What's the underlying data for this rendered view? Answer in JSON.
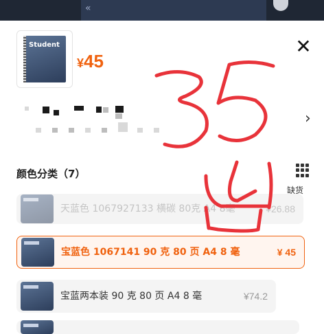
{
  "product": {
    "price_symbol": "¥",
    "price": "45",
    "thumb_title": "Student"
  },
  "section": {
    "title": "颜色分类（7）",
    "out_of_stock": "缺货"
  },
  "options": [
    {
      "label": "天蓝色 1067927133 横碳 80克 A4 8毫",
      "price": "¥26.88",
      "state": "disabled"
    },
    {
      "label": "宝蓝色 1067141 90 克 80 页 A4 8 毫",
      "price": "¥ 45",
      "state": "selected"
    },
    {
      "label": "宝蓝两本装 90 克 80 页 A4 8 毫",
      "price": "¥74.2",
      "state": "normal"
    }
  ],
  "annotation": {
    "text": "35 出",
    "color": "#e8333a"
  },
  "colors": {
    "accent": "#f0620f",
    "panel": "#f4f4f4"
  }
}
